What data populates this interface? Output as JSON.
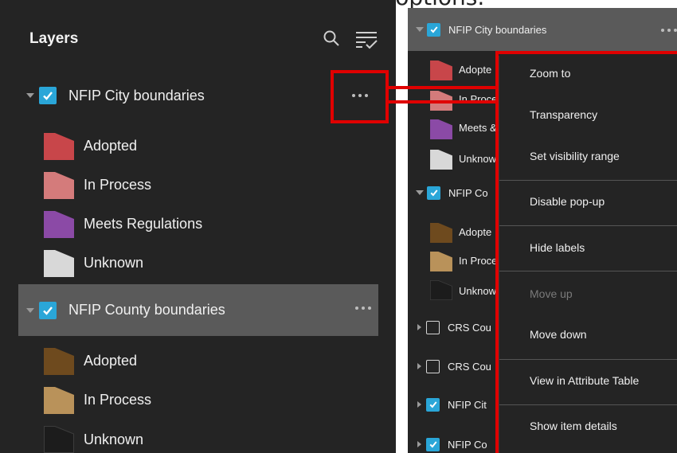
{
  "caption": "the left for more display options.",
  "left": {
    "title": "Layers",
    "icons": [
      "search-icon",
      "filter-list-icon"
    ],
    "layers": [
      {
        "name": "NFIP City boundaries",
        "legend": [
          {
            "label": "Adopted",
            "color": "#c8464a"
          },
          {
            "label": "In Process",
            "color": "#d47b7b"
          },
          {
            "label": "Meets Regulations",
            "color": "#8b4aa6"
          },
          {
            "label": "Unknown",
            "color": "#d8d8d8"
          }
        ]
      },
      {
        "name": "NFIP County boundaries",
        "legend": [
          {
            "label": "Adopted",
            "color": "#6e4a1e"
          },
          {
            "label": "In Process",
            "color": "#b9925a"
          },
          {
            "label": "Unknown",
            "color": "#1c1c1c"
          }
        ]
      }
    ]
  },
  "right": {
    "rows": [
      {
        "label": "NFIP City boundaries"
      },
      {
        "label": "Adopte"
      },
      {
        "label": "In Proce"
      },
      {
        "label": "Meets &"
      },
      {
        "label": "Unknow"
      },
      {
        "label": "NFIP Co"
      },
      {
        "label": "Adopte"
      },
      {
        "label": "In Proce"
      },
      {
        "label": "Unknow"
      },
      {
        "label": "CRS Cou"
      },
      {
        "label": "CRS Cou"
      },
      {
        "label": "NFIP Cit"
      },
      {
        "label": "NFIP Co"
      }
    ]
  },
  "menu": {
    "items": [
      {
        "label": "Zoom to",
        "enabled": true
      },
      {
        "label": "Transparency",
        "enabled": true
      },
      {
        "label": "Set visibility range",
        "enabled": true
      },
      {
        "label": "Disable pop-up",
        "enabled": true
      },
      {
        "label": "Hide labels",
        "enabled": true
      },
      {
        "label": "Move up",
        "enabled": false
      },
      {
        "label": "Move down",
        "enabled": true
      },
      {
        "label": "View in Attribute Table",
        "enabled": true
      },
      {
        "label": "Show item details",
        "enabled": true
      }
    ]
  },
  "colors": {
    "panel_bg": "#242424",
    "accent": "#2aa6d8",
    "highlight": "#e00000",
    "selected_row": "#5a5a5a"
  }
}
